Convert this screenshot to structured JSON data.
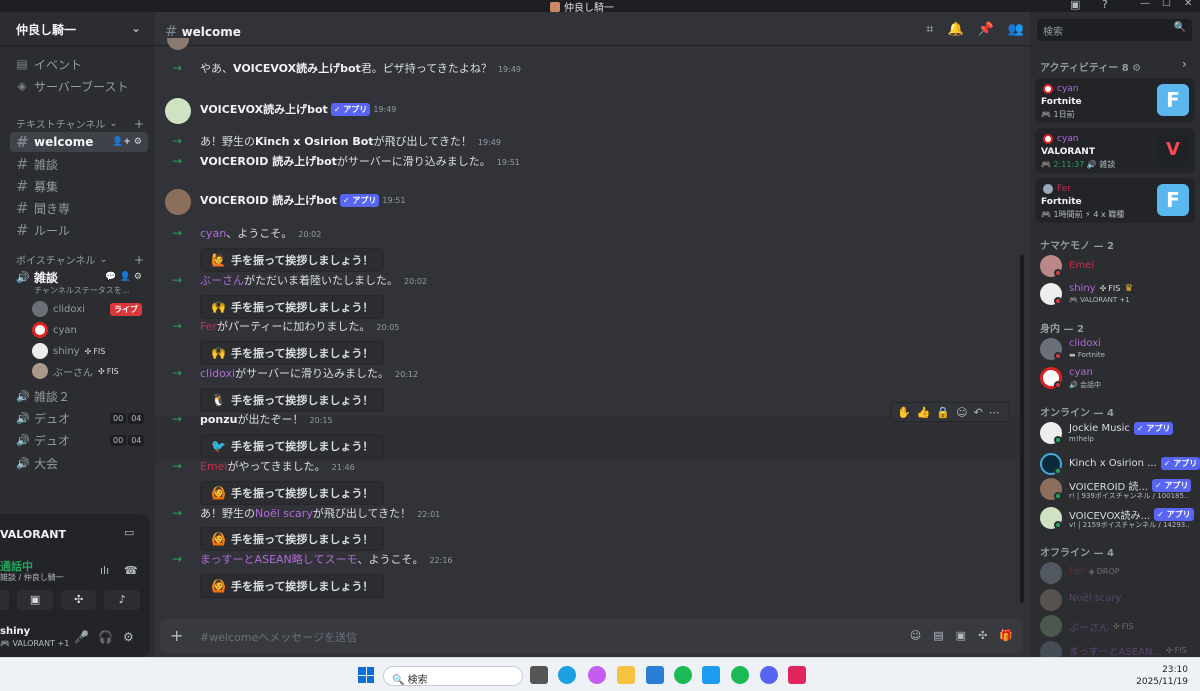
{
  "window": {
    "title": "仲良し騎一"
  },
  "server": {
    "name": "仲良し騎一"
  },
  "sidebar": {
    "events": "イベント",
    "boost": "サーバーブースト",
    "text_category": "テキストチャンネル",
    "text_channels": [
      "welcome",
      "雑談",
      "募集",
      "聞き専",
      "ルール"
    ],
    "voice_category": "ボイスチャンネル",
    "voice1": {
      "name": "雑談",
      "status": "チャンネルステータスを..."
    },
    "voice_users": [
      {
        "name": "clidoxi",
        "live": "ライブ"
      },
      {
        "name": "cyan"
      },
      {
        "name": "shiny",
        "tag": "FIS"
      },
      {
        "name": "ぶーさん",
        "tag": "FIS"
      }
    ],
    "voice2": "雑談２",
    "voice3": {
      "name": "デュオ",
      "c1": "00",
      "c2": "04"
    },
    "voice4": {
      "name": "デュオ",
      "c1": "00",
      "c2": "04"
    },
    "voice5": "大会"
  },
  "panel": {
    "game": "VALORANT",
    "call_status": "通話中",
    "call_sub": "雑談 / 仲良し騎一",
    "user": "shiny",
    "user_sub": "VALORANT +1"
  },
  "channel": {
    "name": "welcome"
  },
  "messages": {
    "m1": {
      "pre": "やあ、",
      "name": "VOICEVOX読み上げbot",
      "post": "君。ピザ持ってきたよね？",
      "time": "19:49"
    },
    "bot1": {
      "name": "VOICEVOX読み上げbot",
      "app": "アプリ",
      "time": "19:49"
    },
    "m2": {
      "pre": "あ！野生の",
      "name": "Kinch x Osirion Bot",
      "post": "が飛び出してきた！",
      "time": "19:49"
    },
    "m3": {
      "name": "VOICEROID 読み上げbot",
      "post": "がサーバーに滑り込みました。",
      "time": "19:51"
    },
    "bot2": {
      "name": "VOICEROID 読み上げbot",
      "app": "アプリ",
      "time": "19:51"
    },
    "m4": {
      "name": "cyan",
      "post": "、ようこそ。",
      "time": "20:02"
    },
    "m5": {
      "name": "ぶーさん",
      "post": "がただいま着陸いたしました。",
      "time": "20:02"
    },
    "m6": {
      "name": "Fer",
      "post": "がパーティーに加わりました。",
      "time": "20:05"
    },
    "m7": {
      "name": "clidoxi",
      "post": "がサーバーに滑り込みました。",
      "time": "20:12"
    },
    "m8": {
      "name": "ponzu",
      "post": "が出たぞー！",
      "time": "20:15"
    },
    "m9": {
      "name": "Emei",
      "post": "がやってきました。",
      "time": "21:46"
    },
    "m10": {
      "pre": "あ！野生の",
      "name": "Noël scary",
      "post": "が飛び出してきた！",
      "time": "22:01"
    },
    "m11": {
      "name": "まっすーとASEAN略してスーモ",
      "post": "、ようこそ。",
      "time": "22:16"
    },
    "wave": "手を振って挨拶しましょう！"
  },
  "composer": {
    "placeholder": "#welcomeへメッセージを送信"
  },
  "members": {
    "search": "検索",
    "activity_head": "アクティビティー 8",
    "cards": [
      {
        "user": "cyan",
        "game": "Fortnite",
        "sub": "1日前"
      },
      {
        "user": "cyan",
        "game": "VALORANT",
        "sub": "2:11:37",
        "extra": "雑談"
      },
      {
        "user": "Fer",
        "game": "Fortnite",
        "sub": "1時間前",
        "extra": "4 x 職種"
      }
    ],
    "namakemono_head": "ナマケモノ — 2",
    "namakemono": [
      {
        "name": "Emei"
      },
      {
        "name": "shiny",
        "tag": "FIS",
        "sub": "VALORANT +1"
      }
    ],
    "mi_head": "身内 — 2",
    "mi": [
      {
        "name": "clidoxi",
        "sub": "Fortnite"
      },
      {
        "name": "cyan",
        "sub": "会話中"
      }
    ],
    "online_head": "オンライン — 4",
    "online": [
      {
        "name": "Jockie Music",
        "app": "アプリ",
        "sub": "m!help"
      },
      {
        "name": "Kinch x Osirion ...",
        "app": "アプリ"
      },
      {
        "name": "VOICEROID 読...",
        "app": "アプリ",
        "sub": "r! | 939ボイスチャンネル / 100185..."
      },
      {
        "name": "VOICEVOX読み...",
        "app": "アプリ",
        "sub": "v! | 2159ボイスチャンネル / 14293..."
      }
    ],
    "offline_head": "オフライン — 4",
    "offline": [
      {
        "name": "Fer",
        "tag": "DROP"
      },
      {
        "name": "Noël scary"
      },
      {
        "name": "ぶーさん",
        "tag": "FIS"
      },
      {
        "name": "まっすーとASEAN...",
        "tag": "FIS"
      }
    ]
  },
  "taskbar": {
    "search": "検索",
    "time": "23:10",
    "date": "2025/11/19"
  }
}
